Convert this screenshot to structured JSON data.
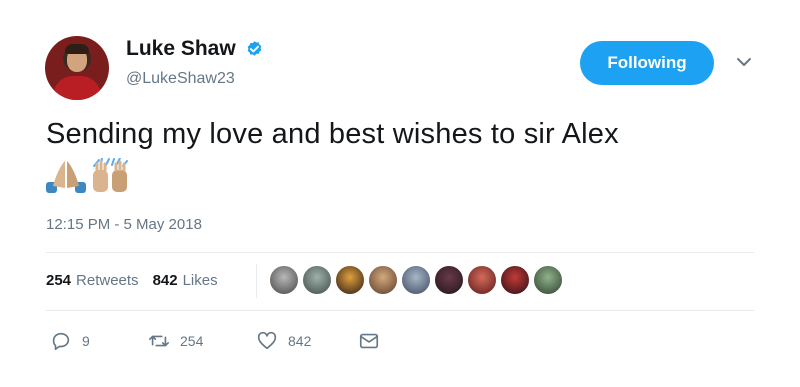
{
  "tweet": {
    "author_name": "Luke Shaw",
    "handle": "@LukeShaw23",
    "verified": true,
    "follow_label": "Following",
    "text": "Sending my love and best wishes to sir Alex",
    "emojis": [
      "folded-hands",
      "raising-hands"
    ],
    "timestamp": "12:15 PM - 5 May 2018"
  },
  "stats": {
    "retweets_count": "254",
    "retweets_label": "Retweets",
    "likes_count": "842",
    "likes_label": "Likes",
    "liker_avatar_count": 9
  },
  "actions": {
    "reply_count": "9",
    "retweet_count": "254",
    "like_count": "842"
  },
  "colors": {
    "accent": "#1da1f2",
    "text": "#14171a",
    "muted": "#657786",
    "divider": "#e6ecf0"
  }
}
